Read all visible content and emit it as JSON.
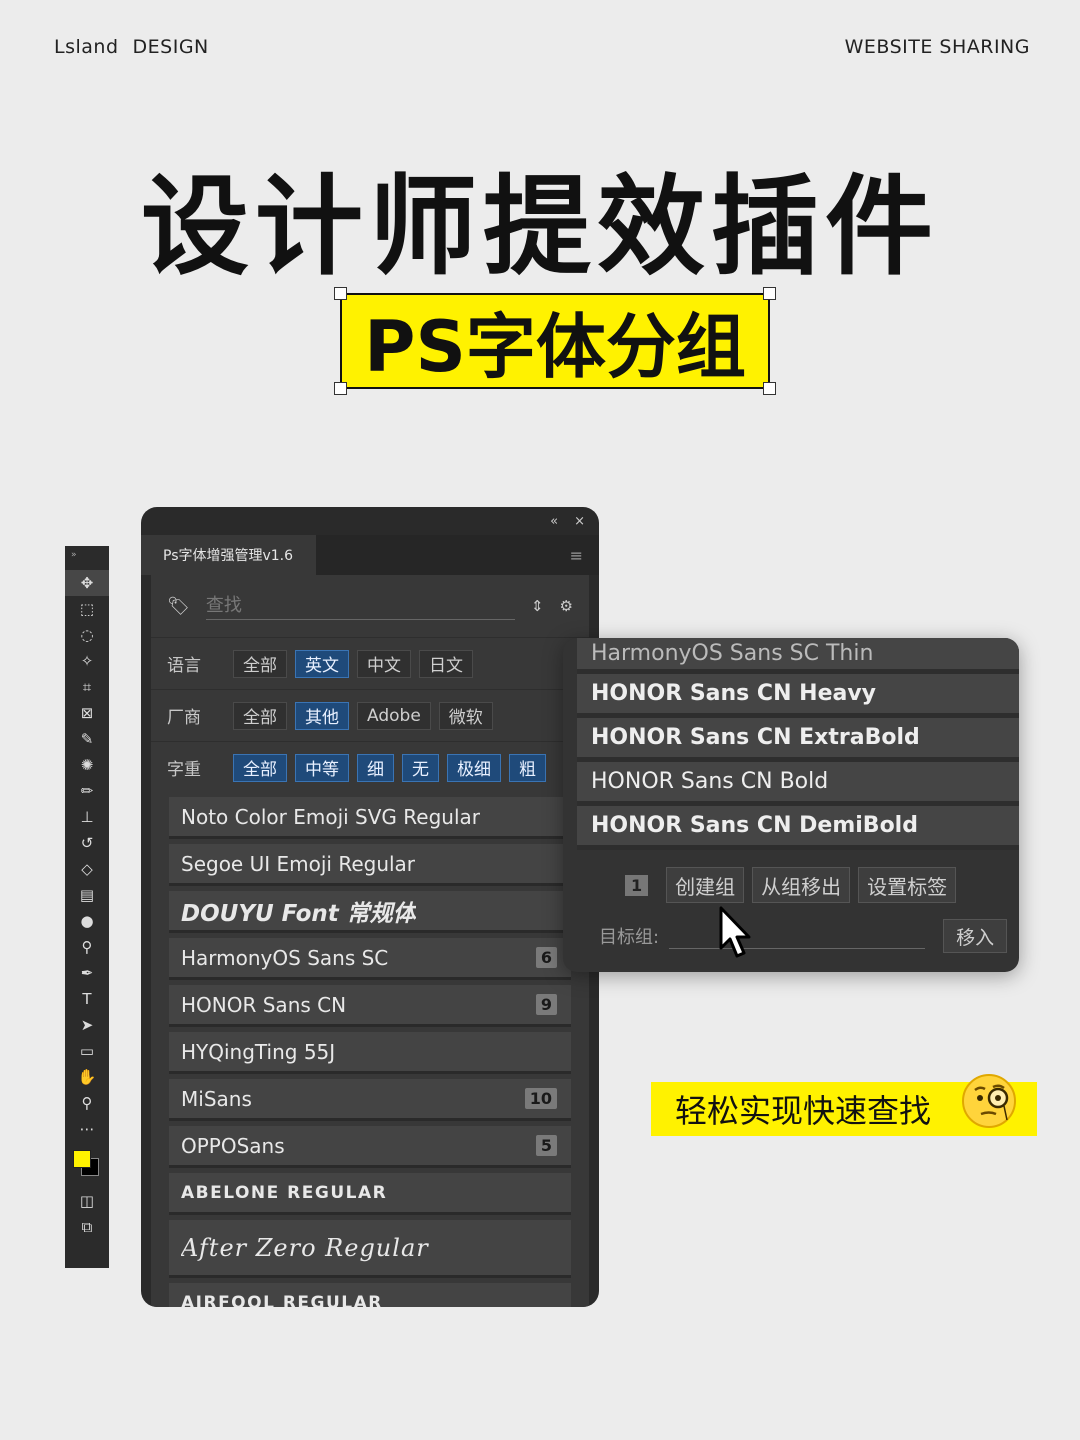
{
  "header": {
    "brand_left_1": "Lsland",
    "brand_left_2": "DESIGN",
    "brand_right": "WEBSITE SHARING"
  },
  "title": "设计师提效插件",
  "subtitle": "PS字体分组",
  "panel": {
    "collapse_icon": "«",
    "close_icon": "×",
    "tab_title": "Ps字体增强管理v1.6",
    "menu_icon": "≡",
    "search_placeholder": "查找",
    "filters": {
      "language": {
        "label": "语言",
        "options": [
          "全部",
          "英文",
          "中文",
          "日文"
        ],
        "selected": "英文"
      },
      "vendor": {
        "label": "厂商",
        "options": [
          "全部",
          "其他",
          "Adobe",
          "微软"
        ],
        "selected": "其他"
      },
      "weight": {
        "label": "字重",
        "options": [
          "全部",
          "中等",
          "细",
          "无",
          "极细",
          "粗"
        ],
        "selected": [
          "全部",
          "中等",
          "细",
          "无",
          "极细",
          "粗"
        ]
      }
    },
    "fonts": [
      {
        "name": "Noto Color Emoji SVG Regular",
        "count": ""
      },
      {
        "name": "Segoe UI Emoji Regular",
        "count": ""
      },
      {
        "name": "DOUYU Font 常规体",
        "count": ""
      },
      {
        "name": "HarmonyOS Sans SC",
        "count": "6"
      },
      {
        "name": "HONOR Sans CN",
        "count": "9"
      },
      {
        "name": "HYQingTing 55J",
        "count": ""
      },
      {
        "name": "MiSans",
        "count": "10"
      },
      {
        "name": "OPPOSans",
        "count": "5"
      },
      {
        "name": "ABELONE REGULAR",
        "count": ""
      },
      {
        "name": "After Zero Regular",
        "count": ""
      },
      {
        "name": "AIRFOOL REGULAR",
        "count": ""
      }
    ]
  },
  "popup": {
    "items": [
      "HarmonyOS Sans SC Thin",
      "HONOR Sans CN Heavy",
      "HONOR Sans CN ExtraBold",
      "HONOR Sans CN Bold",
      "HONOR Sans CN DemiBold"
    ],
    "selected_count": "1",
    "create_group": "创建组",
    "remove_from_group": "从组移出",
    "set_tag": "设置标签",
    "target_label": "目标组:",
    "move_in": "移入"
  },
  "tagline": "轻松实现快速查找",
  "colors": {
    "accent_yellow": "#fff200",
    "chip_selected": "#1f4a7a"
  }
}
